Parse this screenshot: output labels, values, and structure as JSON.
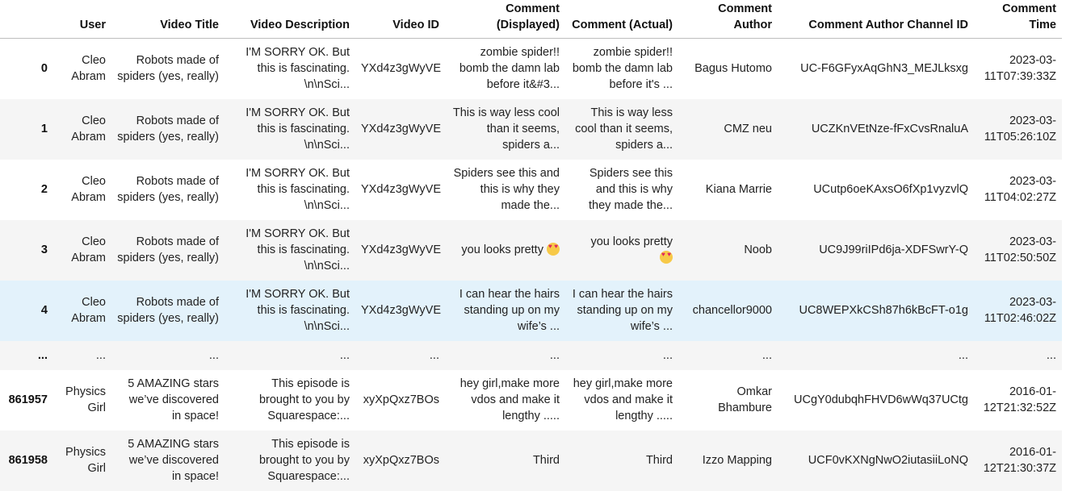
{
  "columns": [
    "",
    "User",
    "Video Title",
    "Video Description",
    "Video ID",
    "Comment (Displayed)",
    "Comment (Actual)",
    "Comment Author",
    "Comment Author Channel ID",
    "Comment Time"
  ],
  "rows": [
    {
      "index": "0",
      "user": "Cleo Abram",
      "title": "Robots made of spiders (yes, really)",
      "description": "I'M SORRY OK. But this is fascinating. \\n\\nSci...",
      "video_id": "YXd4z3gWyVE",
      "comment_displayed": "zombie spider!! bomb the damn lab before it&#3...",
      "comment_actual": "zombie spider!! bomb the damn lab before it's ...",
      "author": "Bagus Hutomo",
      "channel_id": "UC-F6GFyxAqGhN3_MEJLksxg",
      "time": "2023-03-11T07:39:33Z"
    },
    {
      "index": "1",
      "user": "Cleo Abram",
      "title": "Robots made of spiders (yes, really)",
      "description": "I'M SORRY OK. But this is fascinating. \\n\\nSci...",
      "video_id": "YXd4z3gWyVE",
      "comment_displayed": "This is way less cool than it seems, spiders a...",
      "comment_actual": "This is way less cool than it seems, spiders a...",
      "author": "CMZ neu",
      "channel_id": "UCZKnVEtNze-fFxCvsRnaluA",
      "time": "2023-03-11T05:26:10Z"
    },
    {
      "index": "2",
      "user": "Cleo Abram",
      "title": "Robots made of spiders (yes, really)",
      "description": "I'M SORRY OK. But this is fascinating. \\n\\nSci...",
      "video_id": "YXd4z3gWyVE",
      "comment_displayed": "Spiders see this and this is why they made the...",
      "comment_actual": "Spiders see this and this is why they made the...",
      "author": "Kiana Marrie",
      "channel_id": "UCutp6oeKAxsO6fXp1vyzvlQ",
      "time": "2023-03-11T04:02:27Z"
    },
    {
      "index": "3",
      "user": "Cleo Abram",
      "title": "Robots made of spiders (yes, really)",
      "description": "I'M SORRY OK. But this is fascinating. \\n\\nSci...",
      "video_id": "YXd4z3gWyVE",
      "comment_displayed": "you looks pretty",
      "comment_actual": "you looks pretty",
      "author": "Noob",
      "channel_id": "UC9J99riIPd6ja-XDFSwrY-Q",
      "time": "2023-03-11T02:50:50Z"
    },
    {
      "index": "4",
      "user": "Cleo Abram",
      "title": "Robots made of spiders (yes, really)",
      "description": "I'M SORRY OK. But this is fascinating. \\n\\nSci...",
      "video_id": "YXd4z3gWyVE",
      "comment_displayed": "I can hear the hairs standing up on my wife’s ...",
      "comment_actual": "I can hear the hairs standing up on my wife’s ...",
      "author": "chancellor9000",
      "channel_id": "UC8WEPXkCSh87h6kBcFT-o1g",
      "time": "2023-03-11T02:46:02Z"
    },
    {
      "index": "...",
      "user": "...",
      "title": "...",
      "description": "...",
      "video_id": "...",
      "comment_displayed": "...",
      "comment_actual": "...",
      "author": "...",
      "channel_id": "...",
      "time": "..."
    },
    {
      "index": "861957",
      "user": "Physics Girl",
      "title": "5 AMAZING stars we’ve discovered in space!",
      "description": "This episode is brought to you by Squarespace:...",
      "video_id": "xyXpQxz7BOs",
      "comment_displayed": "hey girl,make more vdos and make it lengthy .....",
      "comment_actual": "hey girl,make more vdos and make it lengthy .....",
      "author": "Omkar Bhambure",
      "channel_id": "UCgY0dubqhFHVD6wWq37UCtg",
      "time": "2016-01-12T21:32:52Z"
    },
    {
      "index": "861958",
      "user": "Physics Girl",
      "title": "5 AMAZING stars we’ve discovered in space!",
      "description": "This episode is brought to you by Squarespace:...",
      "video_id": "xyXpQxz7BOs",
      "comment_displayed": "Third",
      "comment_actual": "Third",
      "author": "Izzo Mapping",
      "channel_id": "UCF0vKXNgNwO2iutasiiLoNQ",
      "time": "2016-01-12T21:30:37Z"
    }
  ],
  "emoji": {
    "row_3": "smiling-face-with-heart-eyes-icon"
  }
}
